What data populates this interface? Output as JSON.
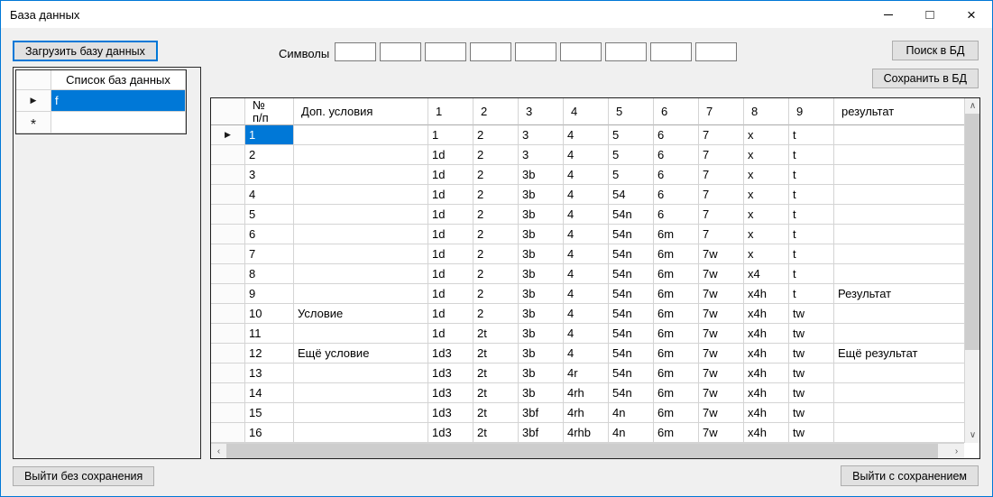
{
  "window": {
    "title": "База данных"
  },
  "icons": {
    "minimize": "minimize-icon",
    "maximize": "□",
    "close": "×",
    "scroll_up": "∧",
    "scroll_down": "∨",
    "scroll_left": "‹",
    "scroll_right": "›",
    "current_row_arrow": "▶",
    "new_row_marker": "*"
  },
  "toolbar": {
    "load_button": "Загрузить базу данных",
    "search_button": "Поиск в БД",
    "save_button": "Сохранить в БД",
    "symbols_label": "Символы",
    "symbol_boxes": [
      "",
      "",
      "",
      "",
      "",
      "",
      "",
      "",
      ""
    ]
  },
  "db_list": {
    "header": "Список баз данных",
    "rows": [
      {
        "value": "f",
        "selected": true,
        "current": true
      },
      {
        "value": "",
        "selected": false,
        "new_row": true
      }
    ]
  },
  "main_grid": {
    "columns": [
      "№\nп/п",
      "Доп. условия",
      "1",
      "2",
      "3",
      "4",
      "5",
      "6",
      "7",
      "8",
      "9",
      "результат"
    ],
    "current_row_index": 0,
    "selected_cell": {
      "row": 0,
      "col": 0
    },
    "rows": [
      [
        "1",
        "",
        "1",
        "2",
        "3",
        "4",
        "5",
        "6",
        "7",
        "x",
        "t",
        ""
      ],
      [
        "2",
        "",
        "1d",
        "2",
        "3",
        "4",
        "5",
        "6",
        "7",
        "x",
        "t",
        ""
      ],
      [
        "3",
        "",
        "1d",
        "2",
        "3b",
        "4",
        "5",
        "6",
        "7",
        "x",
        "t",
        ""
      ],
      [
        "4",
        "",
        "1d",
        "2",
        "3b",
        "4",
        "54",
        "6",
        "7",
        "x",
        "t",
        ""
      ],
      [
        "5",
        "",
        "1d",
        "2",
        "3b",
        "4",
        "54n",
        "6",
        "7",
        "x",
        "t",
        ""
      ],
      [
        "6",
        "",
        "1d",
        "2",
        "3b",
        "4",
        "54n",
        "6m",
        "7",
        "x",
        "t",
        ""
      ],
      [
        "7",
        "",
        "1d",
        "2",
        "3b",
        "4",
        "54n",
        "6m",
        "7w",
        "x",
        "t",
        ""
      ],
      [
        "8",
        "",
        "1d",
        "2",
        "3b",
        "4",
        "54n",
        "6m",
        "7w",
        "x4",
        "t",
        ""
      ],
      [
        "9",
        "",
        "1d",
        "2",
        "3b",
        "4",
        "54n",
        "6m",
        "7w",
        "x4h",
        "t",
        "Результат"
      ],
      [
        "10",
        "Условие",
        "1d",
        "2",
        "3b",
        "4",
        "54n",
        "6m",
        "7w",
        "x4h",
        "tw",
        ""
      ],
      [
        "11",
        "",
        "1d",
        "2t",
        "3b",
        "4",
        "54n",
        "6m",
        "7w",
        "x4h",
        "tw",
        ""
      ],
      [
        "12",
        "Ещё условие",
        "1d3",
        "2t",
        "3b",
        "4",
        "54n",
        "6m",
        "7w",
        "x4h",
        "tw",
        "Ещё результат"
      ],
      [
        "13",
        "",
        "1d3",
        "2t",
        "3b",
        "4r",
        "54n",
        "6m",
        "7w",
        "x4h",
        "tw",
        ""
      ],
      [
        "14",
        "",
        "1d3",
        "2t",
        "3b",
        "4rh",
        "54n",
        "6m",
        "7w",
        "x4h",
        "tw",
        ""
      ],
      [
        "15",
        "",
        "1d3",
        "2t",
        "3bf",
        "4rh",
        "4n",
        "6m",
        "7w",
        "x4h",
        "tw",
        ""
      ],
      [
        "16",
        "",
        "1d3",
        "2t",
        "3bf",
        "4rhb",
        "4n",
        "6m",
        "7w",
        "x4h",
        "tw",
        ""
      ]
    ]
  },
  "footer": {
    "exit_without_save": "Выйти без сохранения",
    "exit_with_save": "Выйти с сохранением"
  },
  "colors": {
    "selection": "#0078d7",
    "accent_border": "#0078d7"
  }
}
